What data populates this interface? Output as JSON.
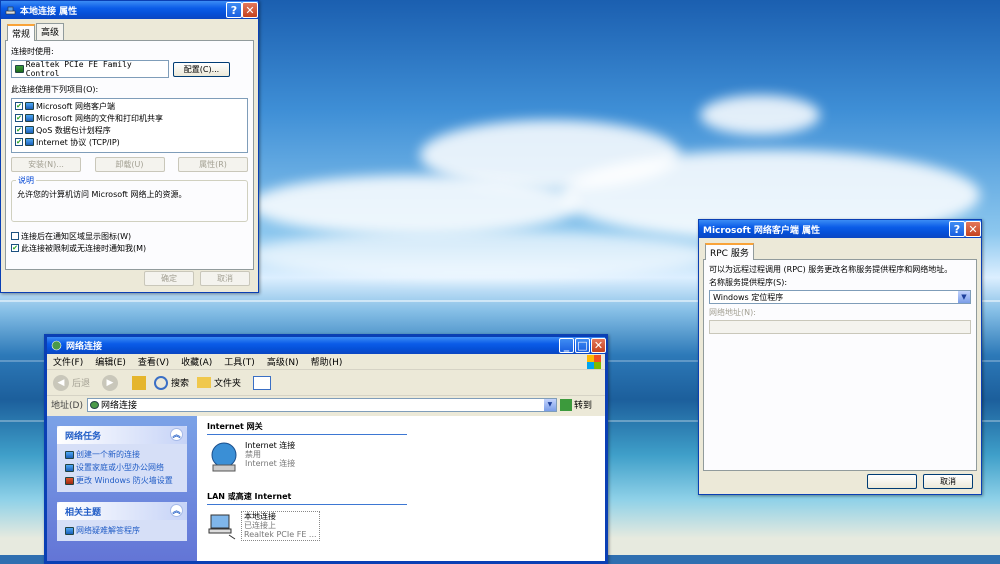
{
  "local_conn": {
    "title": "本地连接 属性",
    "tabs": [
      "常规",
      "高级"
    ],
    "connect_using_label": "连接时使用:",
    "adapter_name": "Realtek PCIe FE Family Control",
    "configure_button": "配置(C)...",
    "items_label": "此连接使用下列项目(O):",
    "items": [
      {
        "label": "Microsoft 网络客户端",
        "checked": true
      },
      {
        "label": "Microsoft 网络的文件和打印机共享",
        "checked": true
      },
      {
        "label": "QoS 数据包计划程序",
        "checked": true
      },
      {
        "label": "Internet 协议 (TCP/IP)",
        "checked": true
      }
    ],
    "install_button": "安装(N)...",
    "uninstall_button": "卸载(U)",
    "properties_button": "属性(R)",
    "description_title": "说明",
    "description_text": "允许您的计算机访问 Microsoft 网络上的资源。",
    "show_icon_label": "连接后在通知区域显示图标(W)",
    "notify_label": "此连接被限制或无连接时通知我(M)",
    "ok_button": "确定",
    "cancel_button": "取消"
  },
  "rpc": {
    "title": "Microsoft 网络客户端 属性",
    "tab": "RPC 服务",
    "description": "可以为远程过程调用 (RPC) 服务更改名称服务提供程序和网络地址。",
    "provider_label": "名称服务提供程序(S):",
    "provider_value": "Windows 定位程序",
    "address_label": "网络地址(N):",
    "cancel_button": "取消"
  },
  "netconn": {
    "title": "网络连接",
    "menu": [
      "文件(F)",
      "编辑(E)",
      "查看(V)",
      "收藏(A)",
      "工具(T)",
      "高级(N)",
      "帮助(H)"
    ],
    "back_label": "后退",
    "search_label": "搜索",
    "folders_label": "文件夹",
    "address_label": "地址(D)",
    "address_value": "网络连接",
    "go_label": "转到",
    "tasks_title": "网络任务",
    "tasks": [
      "创建一个新的连接",
      "设置家庭或小型办公网络",
      "更改 Windows 防火墙设置"
    ],
    "related_title": "相关主题",
    "related": [
      "网络疑难解答程序"
    ],
    "section_gateway": "Internet 网关",
    "gateway": {
      "name": "Internet 连接",
      "status": "禁用",
      "sub": "Internet 连接"
    },
    "section_lan": "LAN 或高速 Internet",
    "lan": {
      "name": "本地连接",
      "status": "已连接上",
      "sub": "Realtek PCIe FE ..."
    }
  }
}
